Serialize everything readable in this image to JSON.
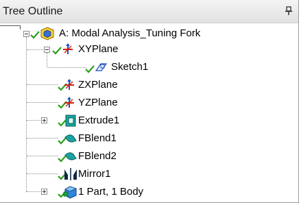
{
  "panel": {
    "title": "Tree Outline"
  },
  "tree": {
    "root": {
      "label": "A: Modal Analysis_Tuning Fork",
      "icon": "analysis-cube-icon"
    },
    "items": [
      {
        "label": "XYPlane",
        "icon": "plane-axis-icon",
        "expanded": true
      },
      {
        "label": "Sketch1",
        "icon": "sketch-icon"
      },
      {
        "label": "ZXPlane",
        "icon": "plane-axis-icon"
      },
      {
        "label": "YZPlane",
        "icon": "plane-axis-icon"
      },
      {
        "label": "Extrude1",
        "icon": "extrude-icon",
        "expanded": false
      },
      {
        "label": "FBlend1",
        "icon": "blend-icon"
      },
      {
        "label": "FBlend2",
        "icon": "blend-icon"
      },
      {
        "label": "Mirror1",
        "icon": "mirror-icon"
      },
      {
        "label": "1 Part, 1 Body",
        "icon": "part-body-icon",
        "expanded": false
      }
    ]
  },
  "colors": {
    "check": "#2aa01a",
    "plane_red": "#d02010",
    "plane_blue": "#1f4fc0",
    "teal": "#0aa0a0"
  }
}
